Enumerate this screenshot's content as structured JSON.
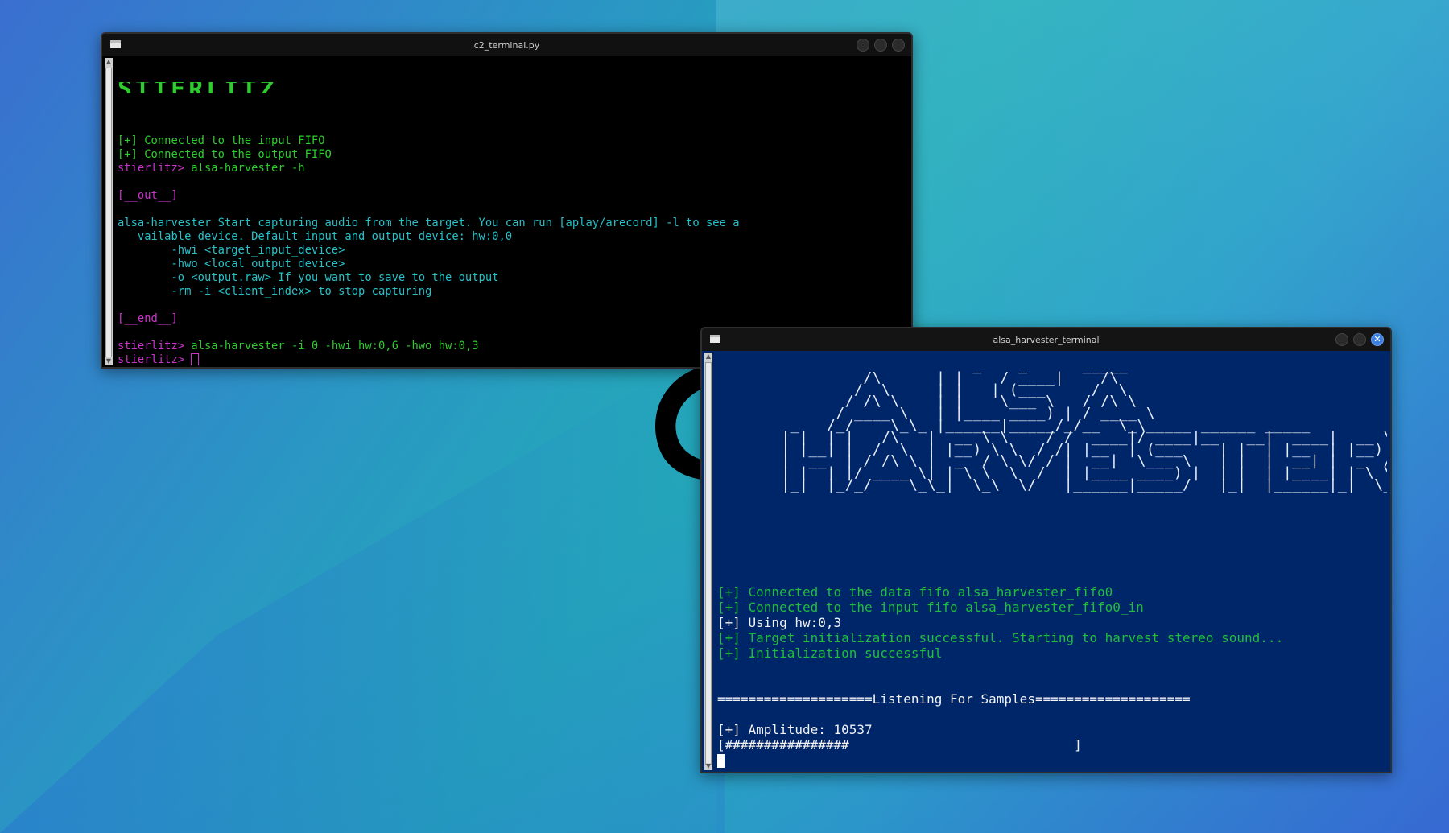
{
  "c2_window": {
    "title": "c2_terminal.py",
    "banner_fragment": "STIERLITZ",
    "lines": [
      {
        "text": "[+] Connected to the input FIFO",
        "color": "green"
      },
      {
        "text": "[+] Connected to the output FIFO",
        "color": "green"
      },
      {
        "prompt": "stierlitz>",
        "command": " alsa-harvester -h"
      },
      {
        "text": "",
        "color": "cyan"
      },
      {
        "text": "[__out__]",
        "color": "magenta"
      },
      {
        "text": "",
        "color": "cyan"
      },
      {
        "text": "alsa-harvester Start capturing audio from the target. You can run [aplay/arecord] -l to see a",
        "color": "cyan"
      },
      {
        "text": "   vailable device. Default input and output device: hw:0,0",
        "color": "cyan"
      },
      {
        "text": "        -hwi <target_input_device>",
        "color": "cyan"
      },
      {
        "text": "        -hwo <local_output_device>",
        "color": "cyan"
      },
      {
        "text": "        -o <output.raw> If you want to save to the output",
        "color": "cyan"
      },
      {
        "text": "        -rm -i <client_index> to stop capturing",
        "color": "cyan"
      },
      {
        "text": "",
        "color": "cyan"
      },
      {
        "text": "[__end__]",
        "color": "magenta"
      },
      {
        "text": "",
        "color": "cyan"
      },
      {
        "prompt": "stierlitz>",
        "command": " alsa-harvester -i 0 -hwi hw:0,6 -hwo hw:0,3"
      },
      {
        "prompt": "stierlitz>",
        "command": " ",
        "cursor": true
      }
    ]
  },
  "alsa_window": {
    "title": "alsa_harvester_terminal",
    "ascii_art": [
      "                      _    _      _____",
      "          /\\      | |    / ____|    /\\",
      "         /  \\     | |   | (___     /  \\",
      "        / /\\ \\    | |    \\___ \\   / /\\ \\",
      "       / ____ \\   | |____ ____) | / ____ \\",
      "  _   /_/    \\_\\_ |______|_____/_/__  \\_\\_____ ______ _____",
      " | |  | |   /\\   |  __ \\ \\    / /  ____|/ ____|__   __|  ____|  __ \\",
      " | |__| |  /  \\  | |__) \\ \\  / /| |__  | (___    | |  | |__  | |__) |",
      " |  __  | / /\\ \\ |  _  / \\ \\/ / |  __|  \\___ \\   | |  |  __| |  _  /",
      " | |  | |/ ____ \\| | \\ \\  \\  /  | |____ ____) |  | |  | |____| | \\ \\",
      " |_|  |_/_/    \\_\\_|  \\_\\  \\/   |______|_____/   |_|  |______|_|  \\_\\"
    ],
    "log": [
      {
        "text": "[+] Connected to the data fifo alsa_harvester_fifo0",
        "color": "green"
      },
      {
        "text": "[+] Connected to the input fifo alsa_harvester_fifo0_in",
        "color": "green"
      },
      {
        "text": "[+] Using hw:0,3",
        "color": "white"
      },
      {
        "text": "[+] Target initialization successful. Starting to harvest stereo sound...",
        "color": "green"
      },
      {
        "text": "[+] Initialization successful",
        "color": "green"
      },
      {
        "text": "",
        "color": "white"
      },
      {
        "text": "",
        "color": "white"
      },
      {
        "text": "====================Listening For Samples====================",
        "color": "white"
      },
      {
        "text": "",
        "color": "white"
      },
      {
        "text": "[+] Amplitude: 10537",
        "color": "white"
      },
      {
        "text": "[################                             ]",
        "color": "white"
      }
    ],
    "amplitude_level": 0.36
  },
  "colors": {
    "desktop_gradient_start": "#3a6fd0",
    "desktop_gradient_mid": "#23aab8",
    "c2_background": "#000000",
    "alsa_background": "#00266a",
    "prompt_magenta": "#cc33cc",
    "text_green": "#2ecc2e",
    "text_cyan": "#27c0c8",
    "close_button_blue": "#3d7fe0"
  },
  "icons": [
    "window-menu-icon",
    "minimize-icon",
    "maximize-icon",
    "close-icon",
    "kali-dragon-wallpaper-icon"
  ]
}
